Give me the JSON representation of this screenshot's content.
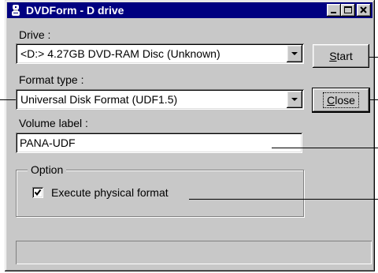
{
  "window": {
    "title": "DVDForm - D drive",
    "icon": "dvd-drive-icon",
    "controls": {
      "minimize": "minimize-icon",
      "maximize": "maximize-icon",
      "close": "close-icon"
    }
  },
  "drive": {
    "label": "Drive :",
    "value": "<D:> 4.27GB DVD-RAM Disc (Unknown)"
  },
  "format_type": {
    "label": "Format type :",
    "value": "Universal Disk Format (UDF1.5)"
  },
  "volume_label": {
    "label": "Volume label :",
    "value": "PANA-UDF"
  },
  "option": {
    "label": "Option",
    "execute_physical_format": {
      "label": "Execute physical format",
      "checked": true
    }
  },
  "buttons": {
    "start": {
      "label": "Start",
      "access_key": "S"
    },
    "close": {
      "label": "Close",
      "access_key": "C"
    }
  },
  "colors": {
    "title_bar": "#000080",
    "title_text": "#ffffff",
    "window_face": "#c8c8c8",
    "field_background": "#ffffff"
  }
}
